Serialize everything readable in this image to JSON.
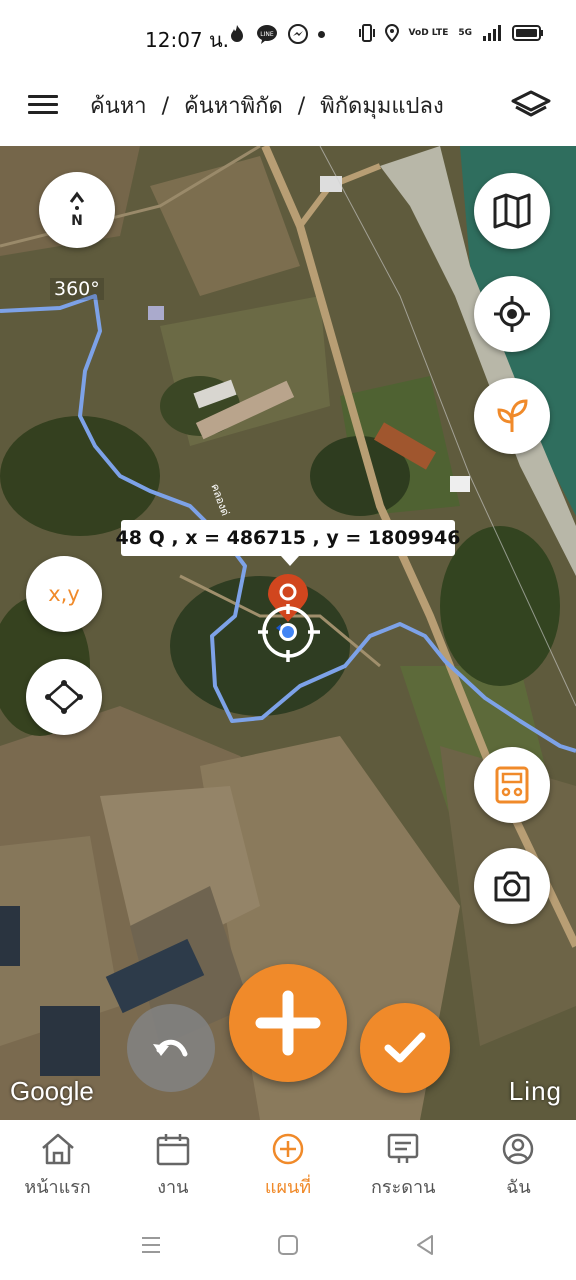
{
  "status": {
    "time": "12:07 น.",
    "network_label": "VoD LTE",
    "signal_label": "5G"
  },
  "topbar": {
    "breadcrumb": [
      "ค้นหา",
      "/",
      "ค้นหาพิกัด",
      "/",
      "พิกัดมุมแปลง"
    ],
    "menu_icon": "hamburger-icon",
    "layers_icon": "layers-icon"
  },
  "map": {
    "compass_letter": "N",
    "compass_label": "360°",
    "xy_label": "x,y",
    "coordinate_label": "48 Q , x = 486715 , y = 1809946",
    "canal_label": "คลองด่",
    "google_label": "Google",
    "ling_label": "Ling",
    "right_buttons": [
      "map-icon",
      "crosshair-icon",
      "sprout-icon",
      "calculator-icon",
      "camera-icon"
    ],
    "colors": {
      "accent": "#f08a2a",
      "marker": "#d1461e",
      "river": "#7da2e8"
    }
  },
  "bottom_nav": {
    "items": [
      {
        "icon": "home-icon",
        "label": "หน้าแรก",
        "active": false
      },
      {
        "icon": "calendar-icon",
        "label": "งาน",
        "active": false
      },
      {
        "icon": "add-circle-icon",
        "label": "แผนที่",
        "active": true
      },
      {
        "icon": "board-icon",
        "label": "กระดาน",
        "active": false
      },
      {
        "icon": "user-icon",
        "label": "ฉัน",
        "active": false
      }
    ]
  }
}
